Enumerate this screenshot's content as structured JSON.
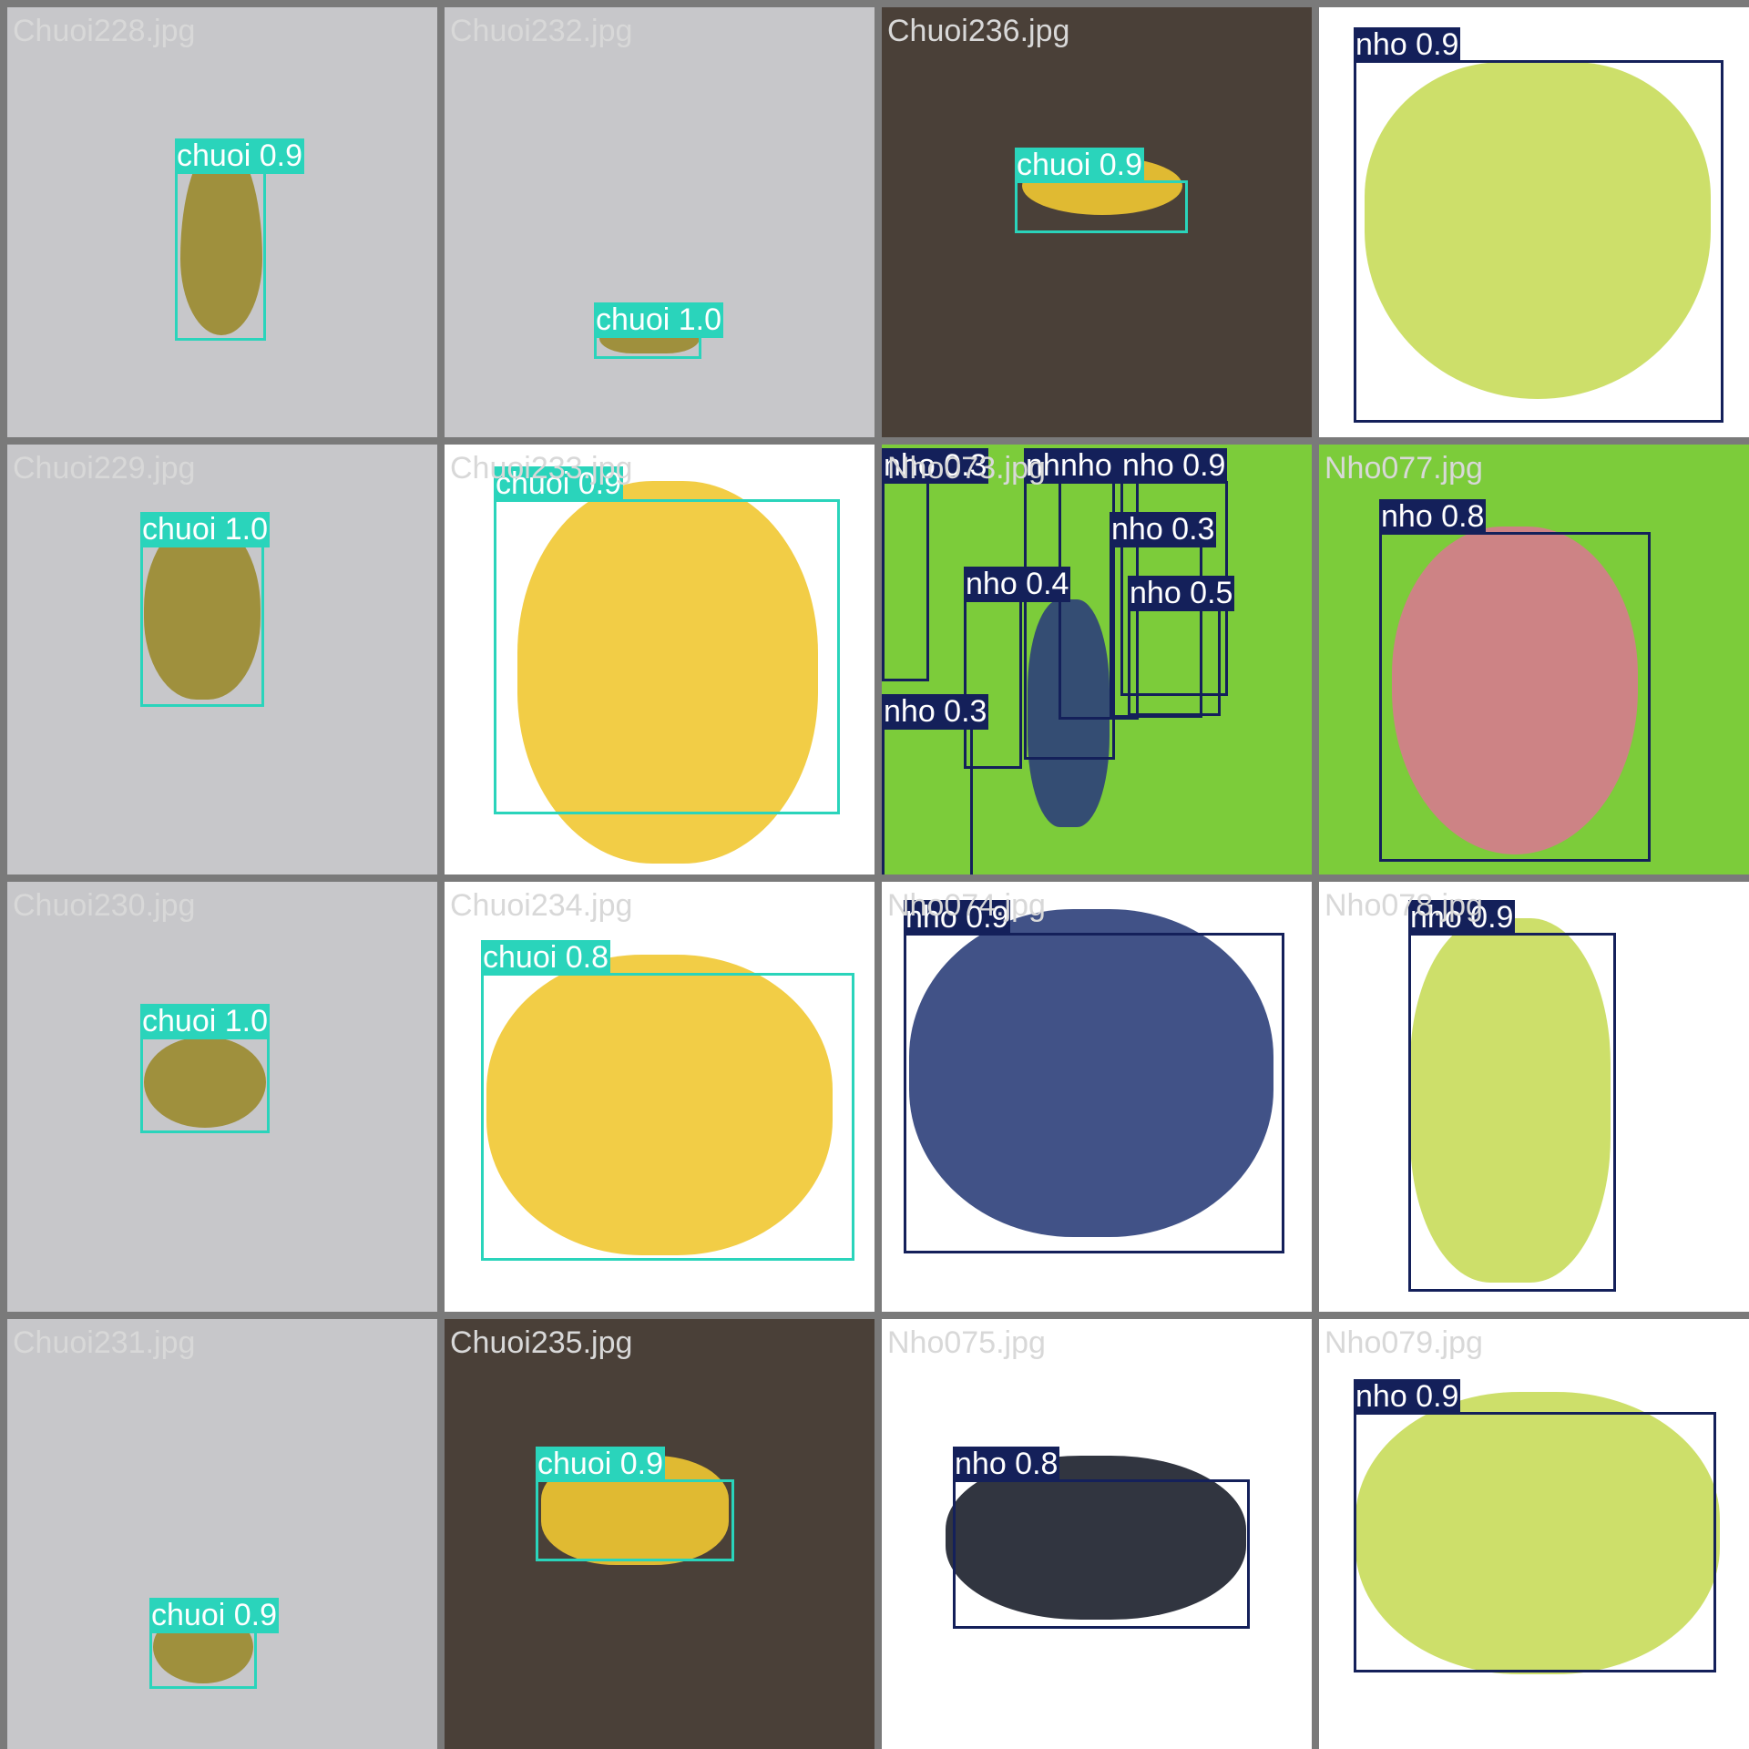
{
  "palette": {
    "chuoi": "#2ad4bb",
    "nho": "#14205a",
    "banana": "#f1c832",
    "banana_dark": "#9a8a2e",
    "grape_green": "#c8dc5a",
    "grape_red": "#d67b8e",
    "grape_blue": "#2c3f7a",
    "grape_black": "#1b1f2b",
    "bg_gray_wall": "#c7c7ca",
    "bg_white": "#ffffff",
    "bg_granite": "#4a4038",
    "bg_vine": "#7ccc3a"
  },
  "tiles": [
    {
      "filename": "Chuoi228.jpg",
      "bg": "bg_gray_wall",
      "fruit": "banana_dark",
      "detections": [
        {
          "label": "chuoi 0.9",
          "cls": "chuoi"
        }
      ]
    },
    {
      "filename": "Chuoi232.jpg",
      "bg": "bg_gray_wall",
      "fruit": "banana_dark",
      "detections": [
        {
          "label": "chuoi 1.0",
          "cls": "chuoi"
        }
      ]
    },
    {
      "filename": "Chuoi236.jpg",
      "bg": "bg_granite",
      "fruit": "banana",
      "detections": [
        {
          "label": "chuoi 0.9",
          "cls": "chuoi"
        }
      ]
    },
    {
      "filename": "",
      "bg": "bg_white",
      "fruit": "grape_green",
      "detections": [
        {
          "label": "nho 0.9",
          "cls": "nho"
        }
      ]
    },
    {
      "filename": "Chuoi229.jpg",
      "bg": "bg_gray_wall",
      "fruit": "banana_dark",
      "detections": [
        {
          "label": "chuoi 1.0",
          "cls": "chuoi"
        }
      ]
    },
    {
      "filename": "Chuoi233.jpg",
      "bg": "bg_white",
      "fruit": "banana",
      "detections": [
        {
          "label": "chuoi 0.9",
          "cls": "chuoi"
        }
      ]
    },
    {
      "filename": "Nho073.jpg",
      "bg": "bg_vine",
      "fruit": "grape_blue",
      "detections": [
        {
          "label": "nho 0.3",
          "cls": "nho"
        },
        {
          "label": "nho",
          "cls": "nho"
        },
        {
          "label": "nho 0.3",
          "cls": "nho"
        },
        {
          "label": "nho 0.9",
          "cls": "nho"
        },
        {
          "label": "nho 0.3",
          "cls": "nho"
        },
        {
          "label": "nho 0.4",
          "cls": "nho"
        },
        {
          "label": "nho 0.5",
          "cls": "nho"
        },
        {
          "label": "nho 0.3",
          "cls": "nho"
        }
      ]
    },
    {
      "filename": "Nho077.jpg",
      "bg": "bg_vine",
      "fruit": "grape_red",
      "detections": [
        {
          "label": "nho 0.8",
          "cls": "nho"
        }
      ]
    },
    {
      "filename": "Chuoi230.jpg",
      "bg": "bg_gray_wall",
      "fruit": "banana_dark",
      "detections": [
        {
          "label": "chuoi 1.0",
          "cls": "chuoi"
        }
      ]
    },
    {
      "filename": "Chuoi234.jpg",
      "bg": "bg_white",
      "fruit": "banana",
      "detections": [
        {
          "label": "chuoi 0.8",
          "cls": "chuoi"
        }
      ]
    },
    {
      "filename": "Nho074.jpg",
      "bg": "bg_white",
      "fruit": "grape_blue",
      "detections": [
        {
          "label": "nho 0.9",
          "cls": "nho"
        }
      ]
    },
    {
      "filename": "Nho078.jpg",
      "bg": "bg_white",
      "fruit": "grape_green",
      "detections": [
        {
          "label": "nho 0.9",
          "cls": "nho"
        }
      ]
    },
    {
      "filename": "Chuoi231.jpg",
      "bg": "bg_gray_wall",
      "fruit": "banana_dark",
      "detections": [
        {
          "label": "chuoi 0.9",
          "cls": "chuoi"
        }
      ]
    },
    {
      "filename": "Chuoi235.jpg",
      "bg": "bg_granite",
      "fruit": "banana",
      "detections": [
        {
          "label": "chuoi 0.9",
          "cls": "chuoi"
        }
      ]
    },
    {
      "filename": "Nho075.jpg",
      "bg": "bg_white",
      "fruit": "grape_black",
      "detections": [
        {
          "label": "nho 0.8",
          "cls": "nho"
        }
      ]
    },
    {
      "filename": "Nho079.jpg",
      "bg": "bg_white",
      "fruit": "grape_green",
      "detections": [
        {
          "label": "nho 0.9",
          "cls": "nho"
        }
      ]
    }
  ]
}
